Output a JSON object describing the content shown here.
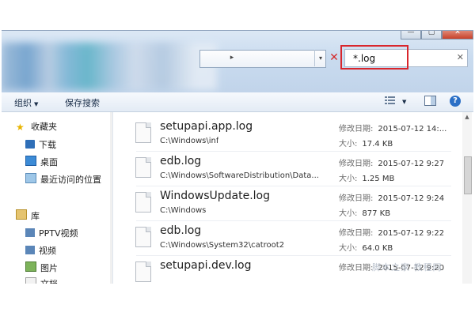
{
  "window": {
    "minimize_glyph": "—",
    "maximize_glyph": "▢",
    "close_glyph": "✕"
  },
  "address": {
    "chevron": "▸",
    "dropdown": "▾",
    "stop_glyph": "✕"
  },
  "search": {
    "value": "*.log",
    "clear_glyph": "✕",
    "highlight_color": "#d9262c"
  },
  "toolbar": {
    "organize_label": "组织",
    "dropdown_glyph": "▼",
    "save_search_label": "保存搜索",
    "view_icon": "view-options-icon",
    "preview_icon": "preview-pane-icon",
    "help_glyph": "?"
  },
  "nav": {
    "favorites": "收藏夹",
    "downloads": "下载",
    "desktop": "桌面",
    "recent": "最近访问的位置",
    "libraries": "库",
    "pptv": "PPTV视频",
    "videos": "视频",
    "pictures": "图片",
    "documents": "文档"
  },
  "labels": {
    "modified": "修改日期:",
    "size": "大小:"
  },
  "files": [
    {
      "name": "setupapi.app.log",
      "path": "C:\\Windows\\inf",
      "modified": "2015-07-12 14:...",
      "size": "17.4 KB"
    },
    {
      "name": "edb.log",
      "path": "C:\\Windows\\SoftwareDistribution\\Data...",
      "modified": "2015-07-12 9:27",
      "size": "1.25 MB"
    },
    {
      "name": "WindowsUpdate.log",
      "path": "C:\\Windows",
      "modified": "2015-07-12 9:24",
      "size": "877 KB"
    },
    {
      "name": "edb.log",
      "path": "C:\\Windows\\System32\\catroot2",
      "modified": "2015-07-12 9:22",
      "size": "64.0 KB"
    },
    {
      "name": "setupapi.dev.log",
      "path": "",
      "modified": "2015-07-12 9:20",
      "size": ""
    }
  ],
  "watermark": "脚本之家 教程网"
}
